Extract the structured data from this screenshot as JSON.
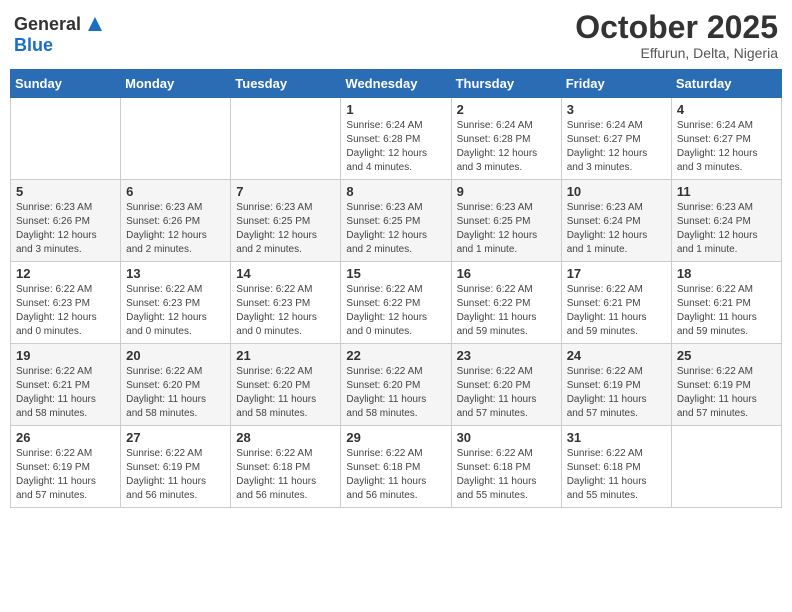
{
  "header": {
    "logo_general": "General",
    "logo_blue": "Blue",
    "title": "October 2025",
    "location": "Effurun, Delta, Nigeria"
  },
  "calendar": {
    "weekdays": [
      "Sunday",
      "Monday",
      "Tuesday",
      "Wednesday",
      "Thursday",
      "Friday",
      "Saturday"
    ],
    "weeks": [
      [
        {
          "day": "",
          "info": ""
        },
        {
          "day": "",
          "info": ""
        },
        {
          "day": "",
          "info": ""
        },
        {
          "day": "1",
          "info": "Sunrise: 6:24 AM\nSunset: 6:28 PM\nDaylight: 12 hours\nand 4 minutes."
        },
        {
          "day": "2",
          "info": "Sunrise: 6:24 AM\nSunset: 6:28 PM\nDaylight: 12 hours\nand 3 minutes."
        },
        {
          "day": "3",
          "info": "Sunrise: 6:24 AM\nSunset: 6:27 PM\nDaylight: 12 hours\nand 3 minutes."
        },
        {
          "day": "4",
          "info": "Sunrise: 6:24 AM\nSunset: 6:27 PM\nDaylight: 12 hours\nand 3 minutes."
        }
      ],
      [
        {
          "day": "5",
          "info": "Sunrise: 6:23 AM\nSunset: 6:26 PM\nDaylight: 12 hours\nand 3 minutes."
        },
        {
          "day": "6",
          "info": "Sunrise: 6:23 AM\nSunset: 6:26 PM\nDaylight: 12 hours\nand 2 minutes."
        },
        {
          "day": "7",
          "info": "Sunrise: 6:23 AM\nSunset: 6:25 PM\nDaylight: 12 hours\nand 2 minutes."
        },
        {
          "day": "8",
          "info": "Sunrise: 6:23 AM\nSunset: 6:25 PM\nDaylight: 12 hours\nand 2 minutes."
        },
        {
          "day": "9",
          "info": "Sunrise: 6:23 AM\nSunset: 6:25 PM\nDaylight: 12 hours\nand 1 minute."
        },
        {
          "day": "10",
          "info": "Sunrise: 6:23 AM\nSunset: 6:24 PM\nDaylight: 12 hours\nand 1 minute."
        },
        {
          "day": "11",
          "info": "Sunrise: 6:23 AM\nSunset: 6:24 PM\nDaylight: 12 hours\nand 1 minute."
        }
      ],
      [
        {
          "day": "12",
          "info": "Sunrise: 6:22 AM\nSunset: 6:23 PM\nDaylight: 12 hours\nand 0 minutes."
        },
        {
          "day": "13",
          "info": "Sunrise: 6:22 AM\nSunset: 6:23 PM\nDaylight: 12 hours\nand 0 minutes."
        },
        {
          "day": "14",
          "info": "Sunrise: 6:22 AM\nSunset: 6:23 PM\nDaylight: 12 hours\nand 0 minutes."
        },
        {
          "day": "15",
          "info": "Sunrise: 6:22 AM\nSunset: 6:22 PM\nDaylight: 12 hours\nand 0 minutes."
        },
        {
          "day": "16",
          "info": "Sunrise: 6:22 AM\nSunset: 6:22 PM\nDaylight: 11 hours\nand 59 minutes."
        },
        {
          "day": "17",
          "info": "Sunrise: 6:22 AM\nSunset: 6:21 PM\nDaylight: 11 hours\nand 59 minutes."
        },
        {
          "day": "18",
          "info": "Sunrise: 6:22 AM\nSunset: 6:21 PM\nDaylight: 11 hours\nand 59 minutes."
        }
      ],
      [
        {
          "day": "19",
          "info": "Sunrise: 6:22 AM\nSunset: 6:21 PM\nDaylight: 11 hours\nand 58 minutes."
        },
        {
          "day": "20",
          "info": "Sunrise: 6:22 AM\nSunset: 6:20 PM\nDaylight: 11 hours\nand 58 minutes."
        },
        {
          "day": "21",
          "info": "Sunrise: 6:22 AM\nSunset: 6:20 PM\nDaylight: 11 hours\nand 58 minutes."
        },
        {
          "day": "22",
          "info": "Sunrise: 6:22 AM\nSunset: 6:20 PM\nDaylight: 11 hours\nand 58 minutes."
        },
        {
          "day": "23",
          "info": "Sunrise: 6:22 AM\nSunset: 6:20 PM\nDaylight: 11 hours\nand 57 minutes."
        },
        {
          "day": "24",
          "info": "Sunrise: 6:22 AM\nSunset: 6:19 PM\nDaylight: 11 hours\nand 57 minutes."
        },
        {
          "day": "25",
          "info": "Sunrise: 6:22 AM\nSunset: 6:19 PM\nDaylight: 11 hours\nand 57 minutes."
        }
      ],
      [
        {
          "day": "26",
          "info": "Sunrise: 6:22 AM\nSunset: 6:19 PM\nDaylight: 11 hours\nand 57 minutes."
        },
        {
          "day": "27",
          "info": "Sunrise: 6:22 AM\nSunset: 6:19 PM\nDaylight: 11 hours\nand 56 minutes."
        },
        {
          "day": "28",
          "info": "Sunrise: 6:22 AM\nSunset: 6:18 PM\nDaylight: 11 hours\nand 56 minutes."
        },
        {
          "day": "29",
          "info": "Sunrise: 6:22 AM\nSunset: 6:18 PM\nDaylight: 11 hours\nand 56 minutes."
        },
        {
          "day": "30",
          "info": "Sunrise: 6:22 AM\nSunset: 6:18 PM\nDaylight: 11 hours\nand 55 minutes."
        },
        {
          "day": "31",
          "info": "Sunrise: 6:22 AM\nSunset: 6:18 PM\nDaylight: 11 hours\nand 55 minutes."
        },
        {
          "day": "",
          "info": ""
        }
      ]
    ]
  }
}
